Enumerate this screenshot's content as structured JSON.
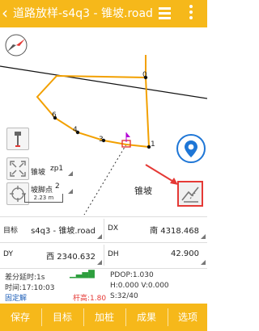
{
  "header": {
    "title": "道路放样-s4q3 - 锥坡.road",
    "icons": {
      "back": "chevron-left-icon",
      "menu": "hamburger-icon",
      "more": "more-vertical-icon"
    }
  },
  "map": {
    "point_labels": [
      "0",
      "6",
      "4",
      "3",
      "1"
    ],
    "slope_label": "锥坡",
    "slope_combo": "zp1",
    "foot_label": "坡脚点",
    "foot_combo": "2",
    "scale_text": "2.23 m"
  },
  "fields": {
    "target_label": "目标",
    "target_value": "s4q3 - 锥坡.road",
    "dx_label": "DX",
    "dx_value": "南 4318.468",
    "dy_label": "DY",
    "dy_value": "西 2340.632",
    "dh_label": "DH",
    "dh_value": "42.900"
  },
  "status": {
    "delay": "差分延时:1s",
    "pdop": "PDOP:1.030",
    "time": "时间:17:10:03",
    "hv": "H:0.000  V:0.000",
    "solution": "固定解",
    "pole": "杆高:1.80",
    "sats": "S:32/40"
  },
  "bottom": [
    "保存",
    "目标",
    "加桩",
    "成果",
    "选项"
  ],
  "colors": {
    "accent": "#f6b81a",
    "fixed": "#1e5fb8",
    "pole": "#e53935",
    "line": "#f2a000"
  }
}
